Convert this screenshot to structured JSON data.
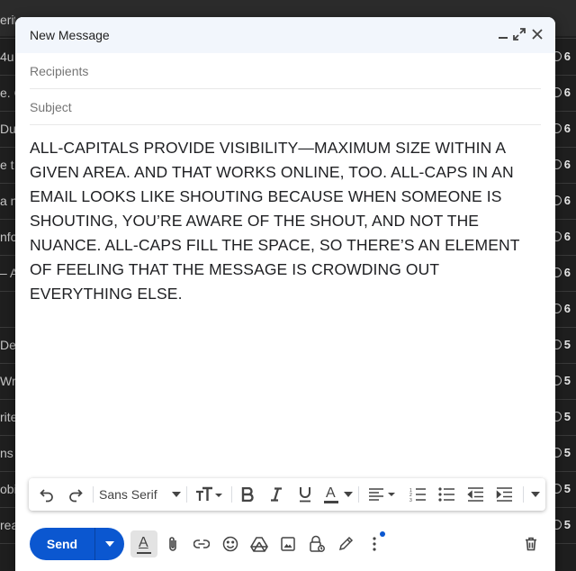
{
  "background": {
    "rows": [
      {
        "left": "erif",
        "right": ""
      },
      {
        "left": "4u",
        "right": "6"
      },
      {
        "left": "e. C",
        "right": "6"
      },
      {
        "left": "Dur",
        "right": "6"
      },
      {
        "left": "e t",
        "right": "6"
      },
      {
        "left": "a n",
        "right": "6"
      },
      {
        "left": "nfo",
        "right": "6"
      },
      {
        "left": "– A",
        "right": "6"
      },
      {
        "left": "",
        "right": "6"
      },
      {
        "left": "De",
        "right": "5"
      },
      {
        "left": "Wri",
        "right": "5"
      },
      {
        "left": "rite",
        "right": "5"
      },
      {
        "left": "ns (",
        "right": "5"
      },
      {
        "left": "obil",
        "right": "5"
      },
      {
        "left": "rea",
        "right": "5"
      }
    ]
  },
  "compose": {
    "title": "New Message",
    "recipients_placeholder": "Recipients",
    "subject_placeholder": "Subject",
    "body": "ALL-CAPITALS PROVIDE VISIBILITY—MAXIMUM SIZE WITHIN A GIVEN AREA. AND THAT WORKS ONLINE, TOO. ALL-CAPS IN AN EMAIL LOOKS LIKE SHOUTING BECAUSE WHEN SOMEONE IS SHOUTING, YOU’RE AWARE OF THE SHOUT, AND NOT THE NUANCE. ALL-CAPS FILL THE SPACE, SO THERE’S AN ELEMENT OF FEELING THAT THE MESSAGE IS CROWDING OUT EVERYTHING ELSE."
  },
  "format_bar": {
    "font": "Sans Serif",
    "text_color_letter": "A"
  },
  "toolbar": {
    "send_label": "Send",
    "formatting_letter": "A"
  },
  "colors": {
    "accent": "#0b57d0",
    "header_bg": "#f2f6fc"
  }
}
